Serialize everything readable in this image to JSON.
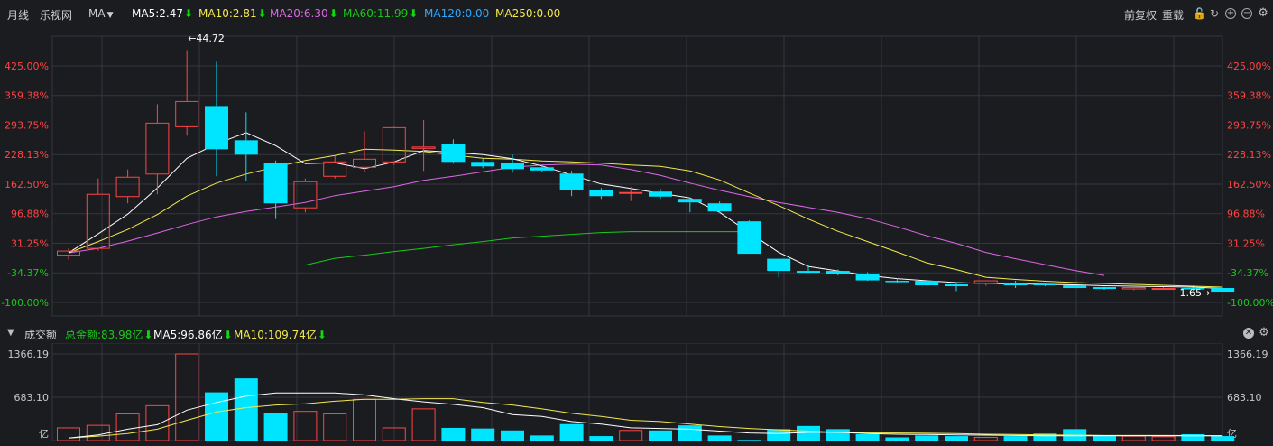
{
  "header": {
    "period": "月线",
    "stock_name": "乐视网",
    "indicator": "MA",
    "ma5": "MA5:2.47",
    "ma10": "MA10:2.81",
    "ma20": "MA20:6.30",
    "ma60": "MA60:11.99",
    "ma120": "MA120:0.00",
    "ma250": "MA250:0.00",
    "fq": "前复权",
    "reset": "重载"
  },
  "colors": {
    "up": "#ff4444",
    "down": "#00e5ff",
    "ma5": "#ffffff",
    "ma10": "#f2e94e",
    "ma20": "#e066e8",
    "ma60": "#19c819",
    "grid": "#343640",
    "axis_green": "#19c819"
  },
  "volume_header": {
    "title": "成交额",
    "total": "总金额:83.98亿",
    "ma5": "MA5:96.86亿",
    "ma10": "MA10:109.74亿"
  },
  "chart_data": {
    "type": "candlestick",
    "price_axis": {
      "ticks": [
        "425.00%",
        "359.38%",
        "293.75%",
        "228.13%",
        "162.50%",
        "96.88%",
        "31.25%",
        "-34.37%",
        "-100.00%"
      ],
      "tick_values": [
        425.0,
        359.38,
        293.75,
        228.13,
        162.5,
        96.88,
        31.25,
        -34.37,
        -100.0
      ]
    },
    "max_label": "←44.72",
    "min_label": "1.65→",
    "candles": [
      {
        "o": 5.0,
        "h": 20.0,
        "l": -5.0,
        "c": 14.0
      },
      {
        "o": 20.0,
        "h": 175.0,
        "l": 15.0,
        "c": 140.0
      },
      {
        "o": 135.0,
        "h": 195.0,
        "l": 120.0,
        "c": 178.0
      },
      {
        "o": 185.0,
        "h": 340.0,
        "l": 140.0,
        "c": 298.0
      },
      {
        "o": 290.0,
        "h": 460.0,
        "l": 270.0,
        "c": 346.0
      },
      {
        "o": 336.0,
        "h": 434.0,
        "l": 180.0,
        "c": 240.0
      },
      {
        "o": 260.0,
        "h": 322.0,
        "l": 170.0,
        "c": 228.0
      },
      {
        "o": 210.0,
        "h": 215.0,
        "l": 85.0,
        "c": 120.0
      },
      {
        "o": 110.0,
        "h": 175.0,
        "l": 100.0,
        "c": 168.0
      },
      {
        "o": 180.0,
        "h": 225.0,
        "l": 175.0,
        "c": 212.0
      },
      {
        "o": 200.0,
        "h": 280.0,
        "l": 190.0,
        "c": 218.0
      },
      {
        "o": 212.0,
        "h": 290.0,
        "l": 205.0,
        "c": 288.0
      },
      {
        "o": 242.0,
        "h": 305.0,
        "l": 192.0,
        "c": 245.0
      },
      {
        "o": 252.0,
        "h": 262.0,
        "l": 208.0,
        "c": 212.0
      },
      {
        "o": 212.0,
        "h": 220.0,
        "l": 198.0,
        "c": 202.0
      },
      {
        "o": 210.0,
        "h": 228.0,
        "l": 188.0,
        "c": 196.0
      },
      {
        "o": 200.0,
        "h": 204.0,
        "l": 190.0,
        "c": 193.0
      },
      {
        "o": 186.0,
        "h": 192.0,
        "l": 136.0,
        "c": 150.0
      },
      {
        "o": 150.0,
        "h": 154.0,
        "l": 130.0,
        "c": 136.0
      },
      {
        "o": 143.0,
        "h": 156.0,
        "l": 125.0,
        "c": 144.0
      },
      {
        "o": 146.0,
        "h": 152.0,
        "l": 130.0,
        "c": 135.0
      },
      {
        "o": 130.0,
        "h": 133.0,
        "l": 100.0,
        "c": 122.0
      },
      {
        "o": 120.0,
        "h": 124.0,
        "l": 98.0,
        "c": 102.0
      },
      {
        "o": 80.0,
        "h": 82.0,
        "l": 8.0,
        "c": 8.0
      },
      {
        "o": -3.0,
        "h": -3.0,
        "l": -45.0,
        "c": -30.0
      },
      {
        "o": -30.0,
        "h": -18.0,
        "l": -35.0,
        "c": -34.0
      },
      {
        "o": -30.0,
        "h": -27.0,
        "l": -40.0,
        "c": -37.0
      },
      {
        "o": -37.0,
        "h": -33.0,
        "l": -52.0,
        "c": -51.0
      },
      {
        "o": -52.0,
        "h": -47.0,
        "l": -58.0,
        "c": -55.0
      },
      {
        "o": -52.0,
        "h": -51.0,
        "l": -64.0,
        "c": -62.0
      },
      {
        "o": -60.0,
        "h": -57.0,
        "l": -75.0,
        "c": -64.0
      },
      {
        "o": -58.0,
        "h": -52.0,
        "l": -63.0,
        "c": -52.0
      },
      {
        "o": -57.0,
        "h": -52.0,
        "l": -68.0,
        "c": -62.0
      },
      {
        "o": -60.0,
        "h": -57.0,
        "l": -64.0,
        "c": -62.0
      },
      {
        "o": -62.0,
        "h": -61.0,
        "l": -68.0,
        "c": -68.0
      },
      {
        "o": -66.0,
        "h": -65.0,
        "l": -72.0,
        "c": -70.0
      },
      {
        "o": -70.0,
        "h": -68.0,
        "l": -73.0,
        "c": -67.0
      },
      {
        "o": -70.0,
        "h": -66.0,
        "l": -72.0,
        "c": -69.0
      },
      {
        "o": -68.0,
        "h": -67.0,
        "l": -74.0,
        "c": -71.0
      },
      {
        "o": -68.0,
        "h": -67.0,
        "l": -76.0,
        "c": -76.0
      }
    ],
    "ma5_line": [
      10,
      52,
      96,
      154,
      220,
      252,
      277,
      248,
      208,
      210,
      197,
      212,
      237,
      233,
      228,
      219,
      203,
      183,
      163,
      153,
      142,
      132,
      100,
      55,
      11,
      -20,
      -30,
      -40,
      -47,
      -52,
      -56,
      -58,
      -59,
      -60,
      -61,
      -63,
      -64,
      -65,
      -66,
      -69
    ],
    "ma10_line": [
      10,
      35,
      62,
      95,
      136,
      165,
      185,
      201,
      215,
      226,
      240,
      238,
      235,
      227,
      220,
      218,
      214,
      212,
      209,
      205,
      202,
      192,
      172,
      143,
      115,
      85,
      58,
      35,
      12,
      -12,
      -27,
      -44,
      -49,
      -53,
      -56,
      -58,
      -60,
      -62,
      -64,
      -66
    ],
    "ma20_line": [
      10,
      20,
      36,
      54,
      73,
      90,
      102,
      112,
      122,
      137,
      147,
      157,
      171,
      180,
      190,
      200,
      205,
      207,
      205,
      195,
      182,
      165,
      149,
      135,
      122,
      111,
      100,
      86,
      68,
      48,
      31,
      11,
      -3,
      -16,
      -29,
      -40
    ],
    "ma20_start": 4,
    "ma60_line": [
      -17,
      -2,
      5,
      13,
      20,
      28,
      35,
      43,
      47,
      51,
      55,
      57,
      57,
      57,
      57,
      57
    ],
    "ma60_start": 8,
    "volume": {
      "ticks": [
        "1366.19",
        "683.10",
        "亿"
      ],
      "tick_values": [
        1366.19,
        683.1,
        0
      ],
      "values": [
        200,
        240,
        420,
        550,
        1366.19,
        760,
        980,
        430,
        460,
        420,
        650,
        200,
        500,
        200,
        190,
        160,
        80,
        260,
        70,
        160,
        160,
        240,
        80,
        10,
        180,
        230,
        180,
        100,
        50,
        80,
        70,
        50,
        70,
        110,
        180,
        70,
        70,
        60,
        100,
        70
      ],
      "ma5": [
        40,
        90,
        180,
        250,
        480,
        600,
        700,
        750,
        750,
        750,
        720,
        660,
        610,
        570,
        520,
        410,
        380,
        300,
        260,
        200,
        190,
        180,
        150,
        120,
        110,
        130,
        130,
        110,
        100,
        95,
        90,
        85,
        80,
        75,
        75,
        75,
        75,
        75,
        75,
        75
      ],
      "ma10": [
        40,
        70,
        110,
        180,
        320,
        450,
        520,
        560,
        580,
        620,
        650,
        650,
        660,
        660,
        600,
        560,
        500,
        430,
        380,
        320,
        300,
        260,
        220,
        190,
        170,
        150,
        130,
        120,
        120,
        115,
        110,
        100,
        95,
        90,
        85,
        80,
        80,
        80,
        78,
        75
      ]
    }
  }
}
